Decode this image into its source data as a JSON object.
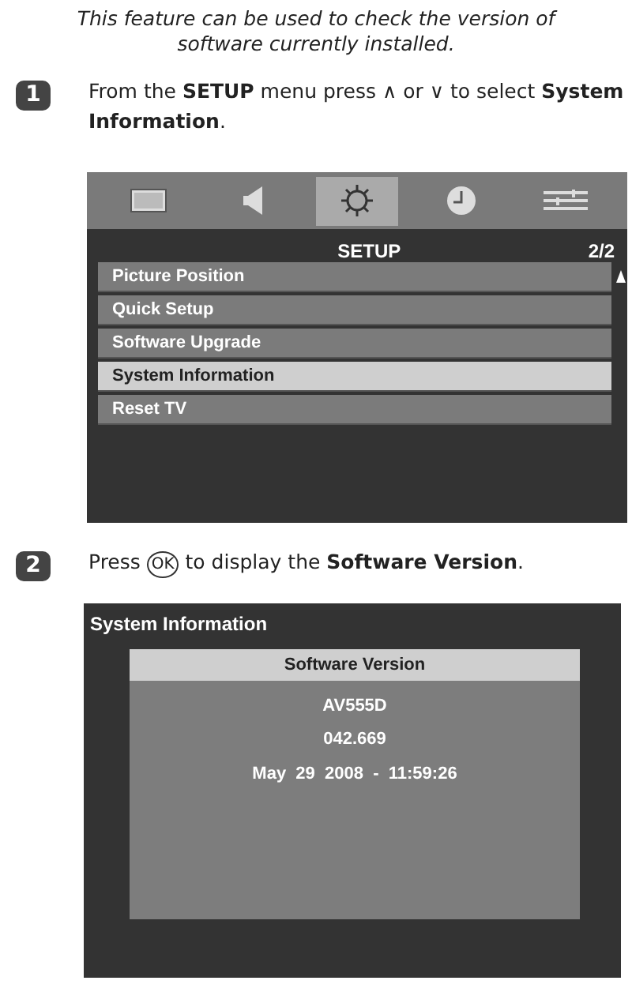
{
  "intro": "This feature can be used to check the version of software currently installed.",
  "steps": [
    {
      "number": "1",
      "parts": [
        {
          "kind": "text",
          "text": "From the **SETUP** menu press ∧ or ∨ to select **System Information**."
        }
      ]
    },
    {
      "number": "2",
      "parts": [
        {
          "kind": "text",
          "text": "Press "
        },
        {
          "kind": "key",
          "text": "OK"
        },
        {
          "kind": "text",
          "text": " to display the **Software Version**."
        }
      ]
    }
  ],
  "menu_screen": {
    "tabs": [
      {
        "kind": "picture",
        "selected": false
      },
      {
        "kind": "sound",
        "selected": false
      },
      {
        "kind": "setup",
        "selected": true
      },
      {
        "kind": "timer",
        "selected": false
      },
      {
        "kind": "preferences",
        "selected": false
      }
    ],
    "title": "SETUP",
    "page": "2/2",
    "items": [
      {
        "label": "Picture Position",
        "selected": false
      },
      {
        "label": "Quick Setup",
        "selected": false
      },
      {
        "label": "Software Upgrade",
        "selected": false
      },
      {
        "label": "System Information",
        "selected": true
      },
      {
        "label": "Reset TV",
        "selected": false
      }
    ]
  },
  "info_screen": {
    "title": "System Information",
    "panel_title": "Software Version",
    "lines": [
      "AV555D",
      "042.669",
      "May  29  2008  -  11:59:26"
    ]
  }
}
